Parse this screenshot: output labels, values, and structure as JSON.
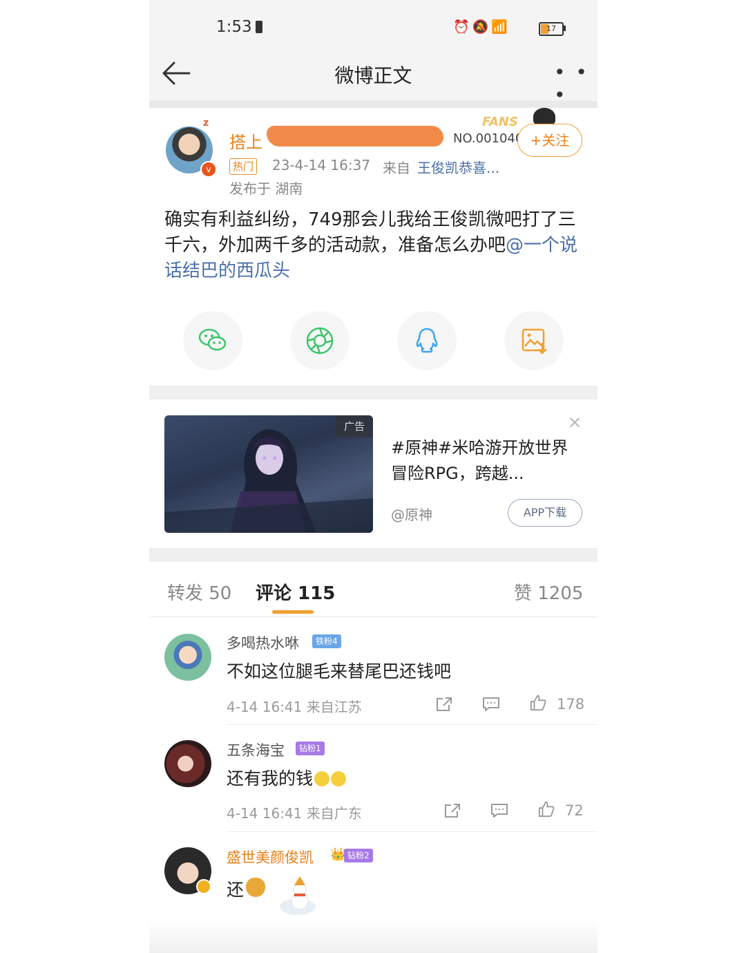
{
  "status_bar": {
    "time": "1:53",
    "battery": "17"
  },
  "nav": {
    "title": "微博正文"
  },
  "post": {
    "author_visible": "搭上",
    "fans_label": "FANS",
    "fans_number": "NO.001040",
    "follow_label": "+关注",
    "hot_tag": "热门",
    "time": "23-4-14 16:37",
    "source_label": "来自",
    "source": "王俊凯恭喜...",
    "location": "发布于 湖南",
    "body_text": "确实有利益纠纷，749那会儿我给王俊凯微吧打了三千六，外加两千多的活动款，准备怎么办吧",
    "body_mention": "@一个说话结巴的西瓜头"
  },
  "share": [
    {
      "name": "wechat-icon"
    },
    {
      "name": "moments-icon"
    },
    {
      "name": "qq-icon"
    },
    {
      "name": "save-image-icon"
    }
  ],
  "ad": {
    "tag": "广告",
    "title": "#原神#米哈游开放世界冒险RPG，跨越...",
    "account": "@原神",
    "download_label": "APP下载"
  },
  "tabs": {
    "repost": "转发 50",
    "comment": "评论 115",
    "like": "赞 1205"
  },
  "comments": [
    {
      "name": "多喝热水咻",
      "badge": "铁粉4",
      "badge_color": "#6aa6e8",
      "text": "不如这位腿毛来替尾巴还钱吧",
      "meta": "4-14 16:41 来自江苏",
      "likes": "178"
    },
    {
      "name": "五条海宝",
      "badge": "钻粉1",
      "badge_color": "#a77ae6",
      "text": "还有我的钱",
      "meta": "4-14 16:41 来自广东",
      "likes": "72"
    },
    {
      "name": "盛世美颜俊凯",
      "badge": "钻粉2",
      "badge_color": "#a77ae6",
      "text": "还",
      "meta": "",
      "likes": ""
    }
  ],
  "colors": {
    "accent": "#f0a030",
    "link": "#4a6fa8",
    "name_orange": "#e8801a"
  }
}
